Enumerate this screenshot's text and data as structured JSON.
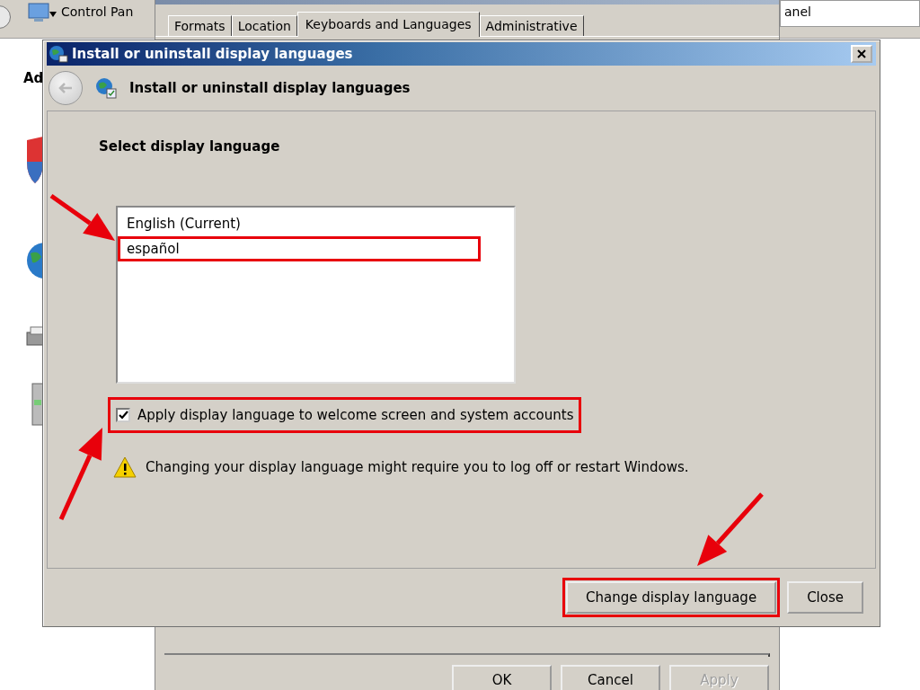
{
  "background_window": {
    "address": "Control Pan",
    "search": "anel",
    "sidebar_label": "Ad"
  },
  "region_dialog": {
    "tabs": [
      {
        "label": "Formats",
        "selected": false
      },
      {
        "label": "Location",
        "selected": false
      },
      {
        "label": "Keyboards and Languages",
        "selected": true
      },
      {
        "label": "Administrative",
        "selected": false
      }
    ],
    "buttons": [
      {
        "label": "OK",
        "disabled": false
      },
      {
        "label": "Cancel",
        "disabled": false
      },
      {
        "label": "Apply",
        "disabled": true
      }
    ]
  },
  "dialog": {
    "title": "Install or uninstall display languages",
    "heading": "Install or uninstall display languages",
    "section_title": "Select display language",
    "languages": [
      {
        "label": "English (Current)",
        "selected": false,
        "highlighted": false
      },
      {
        "label": "español",
        "selected": false,
        "highlighted": true
      }
    ],
    "apply_option": {
      "label": "Apply display language to welcome screen and system accounts",
      "checked": true,
      "highlighted": true
    },
    "warning": "Changing your display language might require you to log off or restart Windows.",
    "buttons": [
      {
        "label": "Change display language",
        "highlighted": true
      },
      {
        "label": "Close",
        "highlighted": false
      }
    ]
  }
}
